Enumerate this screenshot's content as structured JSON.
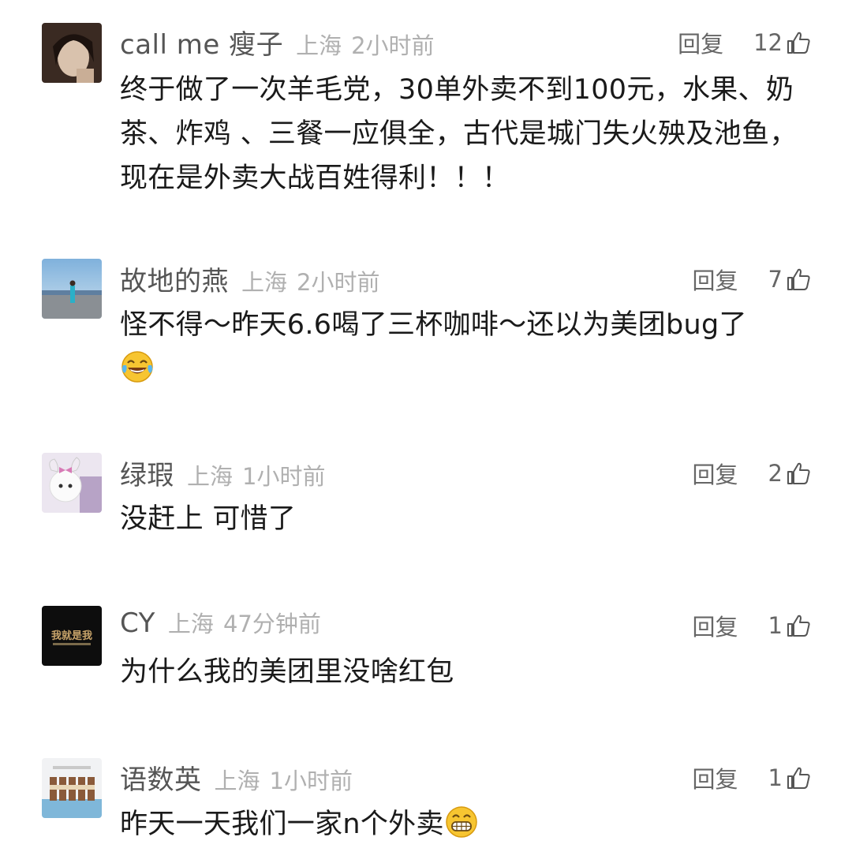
{
  "comments": [
    {
      "username": "call me 瘦子",
      "location": "上海",
      "time": "2小时前",
      "reply_label": "回复",
      "likes": "12",
      "text": "终于做了一次羊毛党，30单外卖不到100元，水果、奶茶、炸鸡 、三餐一应俱全，古代是城门失火殃及池鱼，现在是外卖大战百姓得利！！！",
      "emoji": ""
    },
    {
      "username": "故地的燕",
      "location": "上海",
      "time": "2小时前",
      "reply_label": "回复",
      "likes": "7",
      "text": "怪不得～昨天6.6喝了三杯咖啡～还以为美团bug了",
      "emoji": "tears-of-joy-emoji"
    },
    {
      "username": "绿瑕",
      "location": "上海",
      "time": "1小时前",
      "reply_label": "回复",
      "likes": "2",
      "text": "没赶上 可惜了",
      "emoji": ""
    },
    {
      "username": "CY",
      "location": "上海",
      "time": "47分钟前",
      "reply_label": "回复",
      "likes": "1",
      "text": "为什么我的美团里没啥红包",
      "avatar_text": "我就是我",
      "emoji": ""
    },
    {
      "username": "语数英",
      "location": "上海",
      "time": "1小时前",
      "reply_label": "回复",
      "likes": "1",
      "text": "昨天一天我们一家n个外卖",
      "emoji": "grinning-emoji"
    }
  ],
  "colors": {
    "username": "#555555",
    "meta": "#b0b0b0",
    "action": "#666666",
    "text": "#1a1a1a"
  }
}
